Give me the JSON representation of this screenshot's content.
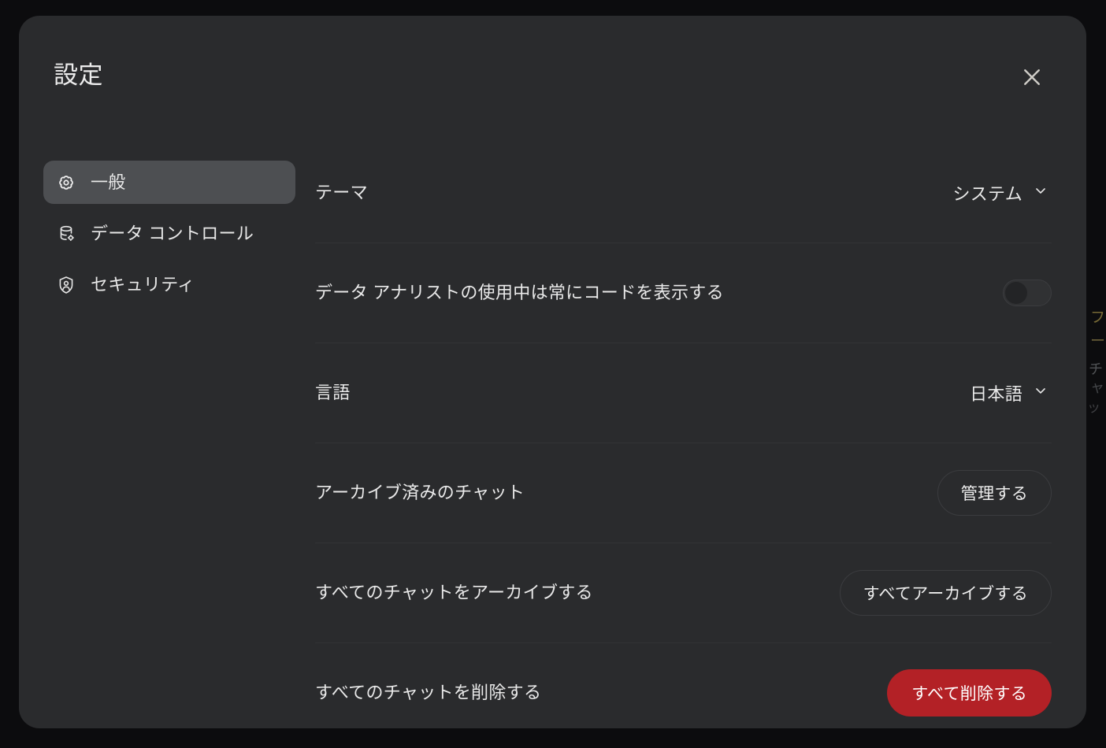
{
  "modal": {
    "title": "設定",
    "close_icon": "close-icon"
  },
  "sidebar": {
    "items": [
      {
        "label": "一般",
        "icon": "gear-icon",
        "active": true
      },
      {
        "label": "データ コントロール",
        "icon": "database-gear-icon",
        "active": false
      },
      {
        "label": "セキュリティ",
        "icon": "shield-person-icon",
        "active": false
      }
    ]
  },
  "settings": {
    "rows": [
      {
        "label": "テーマ",
        "control": "dropdown",
        "value": "システム",
        "chevron_icon": "chevron-down-icon"
      },
      {
        "label": "データ アナリストの使用中は常にコードを表示する",
        "control": "toggle",
        "value": "off"
      },
      {
        "label": "言語",
        "control": "dropdown",
        "value": "日本語",
        "chevron_icon": "chevron-down-icon"
      },
      {
        "label": "アーカイブ済みのチャット",
        "control": "button-outline",
        "value": "管理する"
      },
      {
        "label": "すべてのチャットをアーカイブする",
        "control": "button-outline",
        "value": "すべてアーカイブする"
      },
      {
        "label": "すべてのチャットを削除する",
        "control": "button-danger",
        "value": "すべて削除する"
      }
    ]
  },
  "background": {
    "fragments": [
      "フ",
      "ー",
      "チ",
      "ャ",
      "ッ"
    ]
  },
  "colors": {
    "page_backdrop": "#0c0c0e",
    "modal_surface": "#2a2b2d",
    "sidebar_active": "#4d4f52",
    "danger": "#b32126",
    "text_primary": "#e9e9e9",
    "divider": "#323335"
  }
}
